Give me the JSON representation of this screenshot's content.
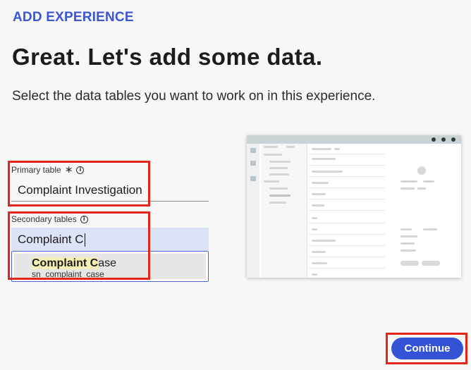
{
  "header": {
    "eyebrow": "ADD EXPERIENCE",
    "title": "Great. Let's add some data.",
    "subtitle": "Select the data tables you want to work on in this experience."
  },
  "primary_table": {
    "label": "Primary table",
    "required_icon": "asterisk-icon",
    "info_icon": "info-icon",
    "value": "Complaint Investigation"
  },
  "secondary_tables": {
    "label": "Secondary tables",
    "info_icon": "info-icon",
    "input_value": "Complaint C",
    "suggestion": {
      "match": "Complaint C",
      "rest": "ase",
      "name": "sn_complaint_case"
    }
  },
  "actions": {
    "continue_label": "Continue"
  },
  "colors": {
    "accent": "#3452d6",
    "highlight_box": "#e3261a",
    "input_bg": "#dde3f6",
    "match_highlight": "#f5efb5"
  }
}
